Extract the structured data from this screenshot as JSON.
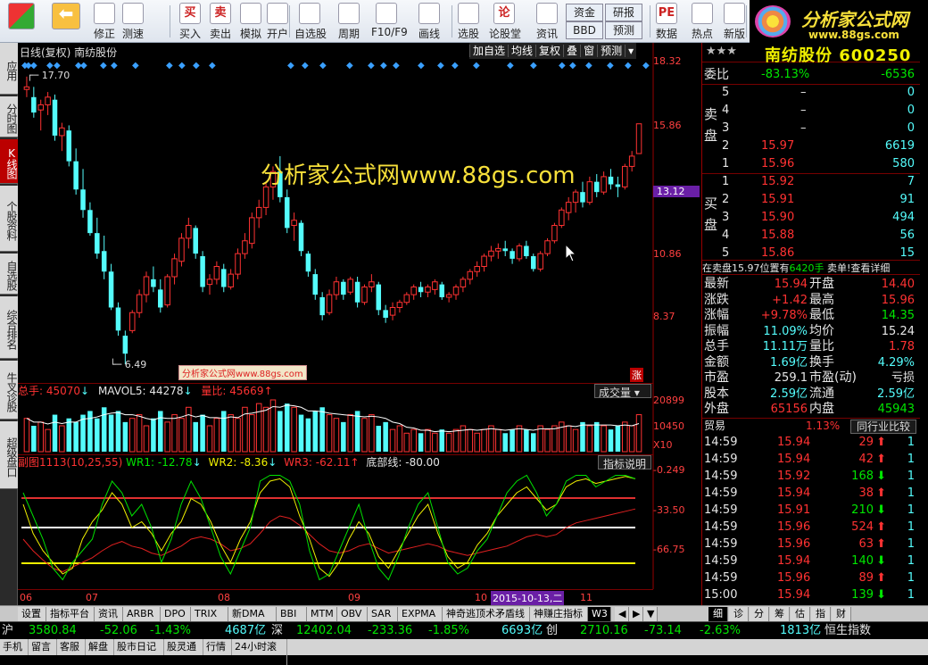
{
  "toolbar": {
    "buttons": [
      {
        "label": "",
        "icon": "windows-logo-icon"
      },
      {
        "label": "",
        "icon": "back-arrow-icon"
      },
      {
        "label": "修正",
        "icon": "updown-icon"
      },
      {
        "label": "测速",
        "icon": "clock-icon"
      },
      {
        "label": "买入",
        "icon": "buy-icon",
        "glyph": "买"
      },
      {
        "label": "卖出",
        "icon": "sell-icon",
        "glyph": "卖"
      },
      {
        "label": "模拟",
        "icon": "hammer-icon"
      },
      {
        "label": "开户",
        "icon": "lock-icon"
      },
      {
        "label": "自选股",
        "icon": "star-icon"
      },
      {
        "label": "周期",
        "icon": "period-icon"
      },
      {
        "label": "F10/F9",
        "icon": "f10-icon"
      },
      {
        "label": "画线",
        "icon": "pen-icon"
      },
      {
        "label": "选股",
        "icon": "screen-icon"
      },
      {
        "label": "论股堂",
        "icon": "forum-icon",
        "glyph": "论"
      },
      {
        "label": "资讯",
        "icon": "news-icon"
      },
      {
        "label": "资金",
        "icon": "fund-icon"
      },
      {
        "label": "研报",
        "icon": "report-icon"
      },
      {
        "label": "BBD",
        "icon": "bbd-icon"
      },
      {
        "label": "预测",
        "icon": "forecast-icon"
      },
      {
        "label": "数据",
        "icon": "pe-icon",
        "glyph": "PE"
      },
      {
        "label": "热点",
        "icon": "hotspot-icon"
      },
      {
        "label": "新版",
        "icon": "new-version-icon"
      }
    ],
    "brand_title": "分析家公式网",
    "brand_url": "www.88gs.com"
  },
  "leftnav": [
    "应用",
    "分时图",
    "K线图",
    "个股资料",
    "自选股",
    "综合排名",
    "牛叉诊股",
    "超级盘口"
  ],
  "chart": {
    "header": "日线(复权)  南纺股份",
    "top_menu": [
      "加自选",
      "均线",
      "复权",
      "叠",
      "窗",
      "预测"
    ],
    "watermark": "分析家公式网www.88gs.com",
    "small_watermark": "分析家公式网www.88gs.com",
    "high_label": "17.70",
    "low_label": "6.49",
    "price_axis": [
      "18.32",
      "15.86",
      "13.12",
      "10.86",
      "8.37"
    ],
    "current_price": "13.12",
    "vol_info": {
      "total": "总手: 45070",
      "mavol": "MAVOL5: 44278",
      "ratio": "量比: 45669"
    },
    "vol_select": "成交量",
    "vol_axis": [
      "20899",
      "10450",
      "X10"
    ],
    "ind_info": {
      "name": "副图1113(10,25,55)",
      "wr1": "WR1: -12.78",
      "wr2": "WR2: -8.36",
      "wr3": "WR3: -62.11",
      "base": "底部线: -80.00"
    },
    "ind_button": "指标说明",
    "ind_axis": [
      "-0.249",
      "-33.50",
      "-66.75"
    ],
    "x_axis": [
      "06",
      "07",
      "08",
      "09",
      "10",
      "11"
    ],
    "date_highlight": "2015-10-13,二",
    "zhang": "涨"
  },
  "chart_data": {
    "type": "candlestick",
    "ylim": [
      6.49,
      18.32
    ],
    "ohlc": [
      [
        17.2,
        17.7,
        16.9,
        17.3
      ],
      [
        16.9,
        17.3,
        16.1,
        16.3
      ],
      [
        16.4,
        16.8,
        15.6,
        16.6
      ],
      [
        16.6,
        17.1,
        16.2,
        16.9
      ],
      [
        16.8,
        17.0,
        15.2,
        15.4
      ],
      [
        15.4,
        15.9,
        14.8,
        15.7
      ],
      [
        15.6,
        15.8,
        14.2,
        14.4
      ],
      [
        14.4,
        14.9,
        13.1,
        13.3
      ],
      [
        13.3,
        14.1,
        12.2,
        12.5
      ],
      [
        12.5,
        12.8,
        11.5,
        11.6
      ],
      [
        11.6,
        12.2,
        10.6,
        10.8
      ],
      [
        10.9,
        11.5,
        9.8,
        10.1
      ],
      [
        10.1,
        10.4,
        8.6,
        8.7
      ],
      [
        8.7,
        8.9,
        7.6,
        7.8
      ],
      [
        7.6,
        7.8,
        6.49,
        6.9
      ],
      [
        7.8,
        8.6,
        7.7,
        8.5
      ],
      [
        8.5,
        9.4,
        8.3,
        9.2
      ],
      [
        9.2,
        10.1,
        8.9,
        9.9
      ],
      [
        9.8,
        10.3,
        9.3,
        9.5
      ],
      [
        9.4,
        9.8,
        8.5,
        8.7
      ],
      [
        8.8,
        10.0,
        8.7,
        9.9
      ],
      [
        9.9,
        10.8,
        9.6,
        10.6
      ],
      [
        10.5,
        11.6,
        10.3,
        11.4
      ],
      [
        11.4,
        12.2,
        11.0,
        11.9
      ],
      [
        11.8,
        11.9,
        10.6,
        10.8
      ],
      [
        10.7,
        10.9,
        9.3,
        9.5
      ],
      [
        9.6,
        10.0,
        9.2,
        9.8
      ],
      [
        9.8,
        10.5,
        9.6,
        10.3
      ],
      [
        10.2,
        10.4,
        9.3,
        9.5
      ],
      [
        9.5,
        10.2,
        9.4,
        10.0
      ],
      [
        10.0,
        11.0,
        9.8,
        10.8
      ],
      [
        10.8,
        11.6,
        10.6,
        11.3
      ],
      [
        11.2,
        12.4,
        11.0,
        12.2
      ],
      [
        12.2,
        12.9,
        11.8,
        12.6
      ],
      [
        12.6,
        13.6,
        12.3,
        13.4
      ],
      [
        13.4,
        14.2,
        12.9,
        14.0
      ],
      [
        14.0,
        14.6,
        12.8,
        13.0
      ],
      [
        13.0,
        13.3,
        11.6,
        11.8
      ],
      [
        11.9,
        12.4,
        11.3,
        12.1
      ],
      [
        12.0,
        12.1,
        10.7,
        10.9
      ],
      [
        10.8,
        10.9,
        9.9,
        10.1
      ],
      [
        10.0,
        10.2,
        9.0,
        9.2
      ],
      [
        9.1,
        9.3,
        8.2,
        8.4
      ],
      [
        8.5,
        9.4,
        8.4,
        9.2
      ],
      [
        9.2,
        9.9,
        9.0,
        9.7
      ],
      [
        9.7,
        9.8,
        9.0,
        9.2
      ],
      [
        9.3,
        9.9,
        9.2,
        9.8
      ],
      [
        9.7,
        9.9,
        8.7,
        8.9
      ],
      [
        8.9,
        9.6,
        8.8,
        9.5
      ],
      [
        9.5,
        10.0,
        9.3,
        9.7
      ],
      [
        9.6,
        9.7,
        8.4,
        8.6
      ],
      [
        8.6,
        8.8,
        8.1,
        8.3
      ],
      [
        8.4,
        8.9,
        8.2,
        8.7
      ],
      [
        8.7,
        9.0,
        8.5,
        8.9
      ],
      [
        8.9,
        9.3,
        8.8,
        9.2
      ],
      [
        9.2,
        9.6,
        9.0,
        9.5
      ],
      [
        9.5,
        9.7,
        9.1,
        9.3
      ],
      [
        9.3,
        9.6,
        9.1,
        9.5
      ],
      [
        9.4,
        9.8,
        9.2,
        9.7
      ],
      [
        9.6,
        9.7,
        9.0,
        9.1
      ],
      [
        9.1,
        9.3,
        8.9,
        9.2
      ],
      [
        9.2,
        9.6,
        9.0,
        9.5
      ],
      [
        9.5,
        9.9,
        9.3,
        9.8
      ],
      [
        9.8,
        10.2,
        9.6,
        10.1
      ],
      [
        10.1,
        10.5,
        9.9,
        10.3
      ],
      [
        10.3,
        10.8,
        10.1,
        10.7
      ],
      [
        10.7,
        11.1,
        10.5,
        10.9
      ],
      [
        10.9,
        11.2,
        10.6,
        11.0
      ],
      [
        11.0,
        11.3,
        10.7,
        10.9
      ],
      [
        10.9,
        11.0,
        10.4,
        10.6
      ],
      [
        10.6,
        11.2,
        10.5,
        11.1
      ],
      [
        11.1,
        11.3,
        10.6,
        10.7
      ],
      [
        10.7,
        10.8,
        10.1,
        10.2
      ],
      [
        10.2,
        10.9,
        10.1,
        10.8
      ],
      [
        10.8,
        11.4,
        10.7,
        11.3
      ],
      [
        11.3,
        12.0,
        11.2,
        11.9
      ],
      [
        11.9,
        12.6,
        11.8,
        12.5
      ],
      [
        12.4,
        13.0,
        12.1,
        12.8
      ],
      [
        12.8,
        13.3,
        12.4,
        13.2
      ],
      [
        13.2,
        13.6,
        12.6,
        12.8
      ],
      [
        12.8,
        13.8,
        12.7,
        13.6
      ],
      [
        13.6,
        13.9,
        13.0,
        13.2
      ],
      [
        13.2,
        14.0,
        13.1,
        13.8
      ],
      [
        13.8,
        14.1,
        13.3,
        13.5
      ],
      [
        13.5,
        13.8,
        13.0,
        13.4
      ],
      [
        13.4,
        14.3,
        13.3,
        14.2
      ],
      [
        14.2,
        14.8,
        14.0,
        14.6
      ],
      [
        14.7,
        15.86,
        14.7,
        15.86
      ]
    ],
    "volumes": [
      9,
      7,
      8,
      6,
      10,
      7,
      9,
      8,
      10,
      11,
      9,
      12,
      10,
      11,
      8,
      9,
      10,
      7,
      9,
      11,
      8,
      10,
      9,
      12,
      8,
      10,
      7,
      9,
      11,
      10,
      9,
      12,
      10,
      13,
      12,
      14,
      11,
      13,
      12,
      10,
      9,
      11,
      12,
      10,
      9,
      8,
      10,
      11,
      9,
      10,
      7,
      8,
      6,
      7,
      5,
      6,
      5,
      6,
      5,
      6,
      5,
      6,
      7,
      6,
      5,
      6,
      7,
      6,
      5,
      6,
      7,
      6,
      5,
      7,
      6,
      7,
      8,
      7,
      6,
      8,
      7,
      8,
      7,
      6,
      7,
      8,
      7,
      10
    ],
    "wr1": [
      -20,
      -40,
      -60,
      -85,
      -95,
      -80,
      -70,
      -60,
      -30,
      -10,
      -20,
      -40,
      -30,
      -50,
      -80,
      -60,
      -30,
      -10,
      -25,
      -50,
      -75,
      -90,
      -70,
      -50,
      -10,
      -5,
      -5,
      -10,
      -30,
      -70,
      -95,
      -90,
      -70,
      -50,
      -30,
      -60,
      -85,
      -95,
      -75,
      -50,
      -30,
      -20,
      -50,
      -80,
      -90,
      -85,
      -70,
      -60,
      -40,
      -20,
      -10,
      -5,
      -20,
      -40,
      -30,
      -10,
      -5,
      -5,
      -15,
      -10,
      -5,
      -5,
      -8
    ],
    "wr2": [
      -30,
      -55,
      -70,
      -80,
      -90,
      -85,
      -60,
      -45,
      -35,
      -20,
      -30,
      -50,
      -45,
      -55,
      -70,
      -55,
      -45,
      -25,
      -30,
      -45,
      -65,
      -80,
      -60,
      -45,
      -20,
      -10,
      -8,
      -15,
      -40,
      -60,
      -85,
      -92,
      -80,
      -60,
      -45,
      -55,
      -75,
      -85,
      -70,
      -55,
      -40,
      -30,
      -55,
      -75,
      -85,
      -80,
      -65,
      -55,
      -40,
      -30,
      -20,
      -15,
      -25,
      -35,
      -30,
      -15,
      -10,
      -8,
      -12,
      -10,
      -8,
      -6,
      -8
    ],
    "wr3": [
      -60,
      -70,
      -78,
      -85,
      -88,
      -84,
      -80,
      -76,
      -70,
      -65,
      -62,
      -66,
      -68,
      -72,
      -74,
      -70,
      -66,
      -60,
      -58,
      -60,
      -64,
      -70,
      -68,
      -64,
      -55,
      -45,
      -40,
      -42,
      -48,
      -56,
      -64,
      -70,
      -72,
      -70,
      -66,
      -64,
      -68,
      -72,
      -70,
      -68,
      -66,
      -64,
      -66,
      -70,
      -72,
      -74,
      -72,
      -70,
      -68,
      -66,
      -62,
      -58,
      -56,
      -58,
      -56,
      -50,
      -46,
      -44,
      -42,
      -40,
      -38,
      -36,
      -34
    ],
    "ind_ylim": [
      -100,
      0
    ]
  },
  "quote": {
    "stars": "★★★",
    "name_code": "南纺股份 600250",
    "webi_label": "委比",
    "webi_pct": "-83.13%",
    "webi_val": "-6536",
    "sell_label": "卖盘",
    "buy_label": "买盘",
    "sell": [
      [
        "5",
        "–",
        "0"
      ],
      [
        "4",
        "–",
        "0"
      ],
      [
        "3",
        "–",
        "0"
      ],
      [
        "2",
        "15.97",
        "6619"
      ],
      [
        "1",
        "15.96",
        "580"
      ]
    ],
    "buy": [
      [
        "1",
        "15.92",
        "7"
      ],
      [
        "2",
        "15.91",
        "91"
      ],
      [
        "3",
        "15.90",
        "494"
      ],
      [
        "4",
        "15.88",
        "56"
      ],
      [
        "5",
        "15.86",
        "15"
      ]
    ],
    "notice_a": "在卖盘15.97位置有",
    "notice_b": "6420手",
    "notice_c": "卖单!",
    "notice_d": "查看详细",
    "stats": [
      [
        "最新",
        "15.94",
        "开盘",
        "14.40"
      ],
      [
        "涨跌",
        "+1.42",
        "最高",
        "15.96"
      ],
      [
        "涨幅",
        "+9.78%",
        "最低",
        "14.35"
      ],
      [
        "振幅",
        "11.09%",
        "均价",
        "15.24"
      ],
      [
        "总手",
        "11.11万",
        "量比",
        "1.78"
      ],
      [
        "金额",
        "1.69亿",
        "换手",
        "4.29%"
      ],
      [
        "市盈",
        "259.1",
        "市盈(动)",
        "亏损"
      ],
      [
        "股本",
        "2.59亿",
        "流通",
        "2.59亿"
      ],
      [
        "外盘",
        "65156",
        "内盘",
        "45943"
      ]
    ],
    "industry": "贸易",
    "industry_pct": "1.13%",
    "industry_btn": "同行业比较",
    "ticks": [
      [
        "14:59",
        "15.94",
        "29",
        "up",
        "1"
      ],
      [
        "14:59",
        "15.94",
        "42",
        "up",
        "1"
      ],
      [
        "14:59",
        "15.92",
        "168",
        "down",
        "1"
      ],
      [
        "14:59",
        "15.94",
        "38",
        "up",
        "1"
      ],
      [
        "14:59",
        "15.91",
        "210",
        "down",
        "1"
      ],
      [
        "14:59",
        "15.96",
        "524",
        "up",
        "1"
      ],
      [
        "14:59",
        "15.96",
        "63",
        "up",
        "1"
      ],
      [
        "14:59",
        "15.94",
        "140",
        "down",
        "1"
      ],
      [
        "14:59",
        "15.96",
        "89",
        "up",
        "1"
      ],
      [
        "15:00",
        "15.94",
        "139",
        "down",
        "1"
      ]
    ],
    "right_tabs": [
      "细",
      "诊",
      "分",
      "筹",
      "估",
      "指",
      "财"
    ]
  },
  "bottom_tabs": [
    "设置",
    "指标平台",
    "资讯",
    "ARBR",
    "DPO",
    "TRIX",
    "新DMA",
    "BBI",
    "MTM",
    "OBV",
    "SAR",
    "EXPMA",
    "神奇逃顶术矛盾线",
    "神赚庄指标",
    "W3"
  ],
  "ticker": {
    "sh_label": "沪",
    "sh_val": "3580.84",
    "sh_chg": "-52.06",
    "sh_pct": "-1.43%",
    "sh_amt": "4687亿",
    "sz_label": "深",
    "sz_val": "12402.04",
    "sz_chg": "-233.36",
    "sz_pct": "-1.85%",
    "sz_amt": "6693亿",
    "cy_label": "创",
    "cy_val": "2710.16",
    "cy_chg": "-73.14",
    "cy_pct": "-2.63%",
    "cy_amt": "1813亿",
    "hs_label": "恒生指数"
  },
  "status": [
    "手机",
    "留言",
    "客服",
    "解盘",
    "股市日记",
    "股灵通",
    "行情",
    "24小时滚动"
  ],
  "colors": {
    "up": "#ff3232",
    "down": "#54fcfc",
    "ma_white": "#ffffff",
    "ma_yellow": "#f0f000",
    "accent": "#c00000"
  }
}
